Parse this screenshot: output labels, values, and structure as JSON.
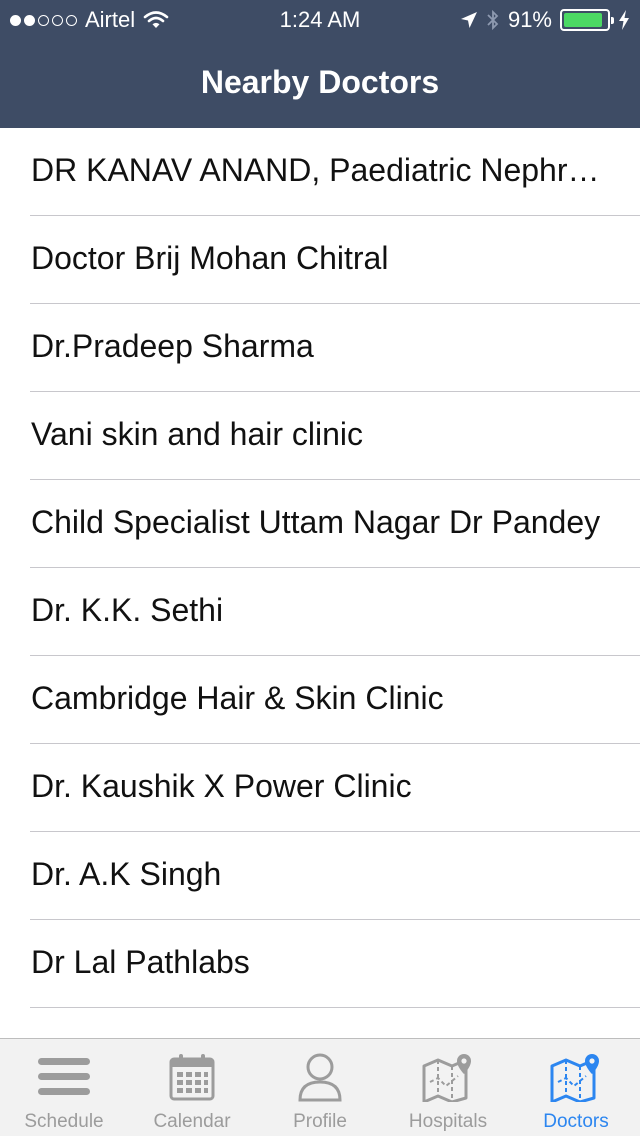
{
  "status_bar": {
    "carrier": "Airtel",
    "time": "1:24 AM",
    "battery": "91%",
    "battery_level": 0.91
  },
  "nav": {
    "title": "Nearby Doctors"
  },
  "doctors": [
    "DR KANAV ANAND, Paediatric Nephrologist",
    "Doctor Brij Mohan Chitral",
    "Dr.Pradeep Sharma",
    "Vani skin and hair clinic",
    "Child Specialist Uttam Nagar Dr Pandey",
    "Dr. K.K. Sethi",
    "Cambridge Hair & Skin Clinic",
    "Dr. Kaushik X Power Clinic",
    "Dr. A.K Singh",
    "Dr Lal Pathlabs"
  ],
  "tabs": [
    {
      "label": "Schedule",
      "icon": "menu-lines-icon"
    },
    {
      "label": "Calendar",
      "icon": "calendar-icon"
    },
    {
      "label": "Profile",
      "icon": "person-icon"
    },
    {
      "label": "Hospitals",
      "icon": "map-pin-icon"
    },
    {
      "label": "Doctors",
      "icon": "map-pin-icon"
    }
  ],
  "colors": {
    "nav_bg": "#3e4c65",
    "tab_active": "#2c86f0",
    "tab_inactive": "#9c9c9c"
  }
}
